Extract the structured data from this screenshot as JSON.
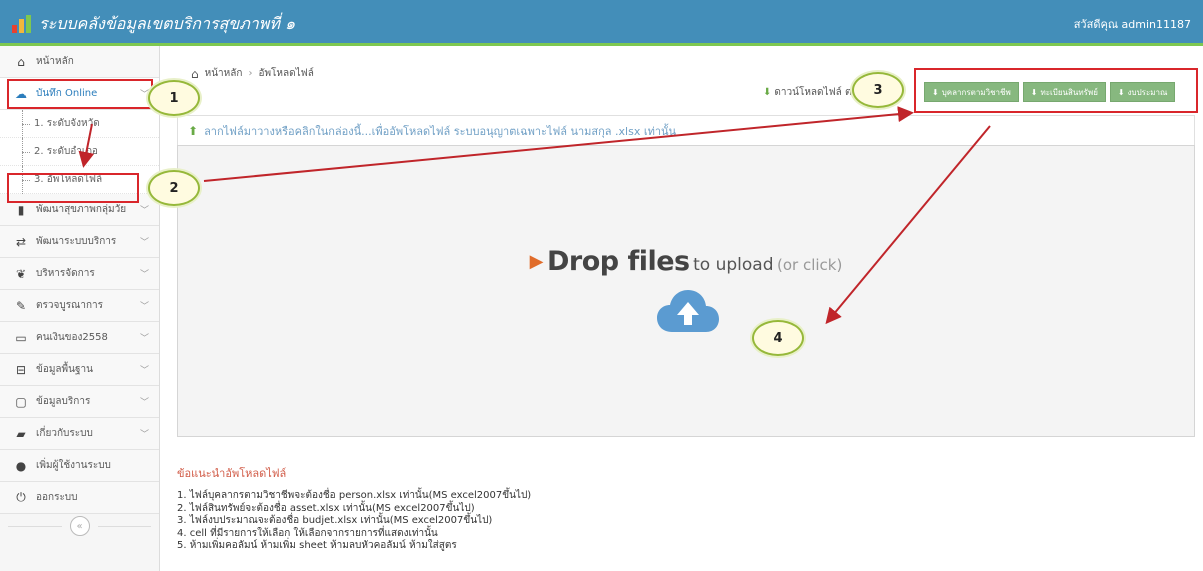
{
  "app": {
    "title": "ระบบคลังข้อมูลเขตบริการสุขภาพที่ ๑",
    "user_greeting": "สวัสดีคุณ admin11187",
    "brand_colors": [
      "#e8412f",
      "#f3b73b",
      "#7ec850"
    ]
  },
  "sidebar": {
    "items": [
      {
        "label": "หน้าหลัก",
        "icon": "home-icon",
        "glyph": "⌂"
      },
      {
        "label": "บันทึก Online",
        "icon": "cloud-upload-icon",
        "glyph": "☁",
        "expanded": true,
        "children": [
          {
            "label": "1. ระดับจังหวัด"
          },
          {
            "label": "2. ระดับอำเภอ"
          },
          {
            "label": "3. อัพโหลดไฟล์",
            "active": true
          }
        ]
      },
      {
        "label": "พัฒนาสุขภาพกลุ่มวัย",
        "icon": "bookmark-icon",
        "glyph": "▮"
      },
      {
        "label": "พัฒนาระบบบริการ",
        "icon": "exchange-icon",
        "glyph": "⇄"
      },
      {
        "label": "บริหารจัดการ",
        "icon": "leaf-icon",
        "glyph": "❦"
      },
      {
        "label": "ตรวจบูรณาการ",
        "icon": "eyedropper-icon",
        "glyph": "✎"
      },
      {
        "label": "คนเงินของ2558",
        "icon": "credit-card-icon",
        "glyph": "▭"
      },
      {
        "label": "ข้อมูลพื้นฐาน",
        "icon": "hdd-icon",
        "glyph": "⊟"
      },
      {
        "label": "ข้อมูลบริการ",
        "icon": "desktop-icon",
        "glyph": "▢"
      },
      {
        "label": "เกี่ยวกับระบบ",
        "icon": "book-icon",
        "glyph": "▰"
      },
      {
        "label": "เพิ่มผู้ใช้งานระบบ",
        "icon": "user-icon",
        "glyph": "●"
      },
      {
        "label": "ออกระบบ",
        "icon": "power-icon",
        "glyph": "⏻"
      }
    ],
    "collapse_glyph": "«"
  },
  "breadcrumb": {
    "home": "หน้าหลัก",
    "current": "อัพโหลดไฟล์",
    "separator": "›"
  },
  "download": {
    "label": "ดาวน์โหลดไฟล์ ต",
    "buttons": [
      {
        "label": "บุคลากรตามวิชาชีพ"
      },
      {
        "label": "ทะเบียนสินทรัพย์"
      },
      {
        "label": "งบประมาณ"
      }
    ]
  },
  "dropzone": {
    "header": "ลากไฟล์มาวางหรือคลิกในกล่องนี้...เพื่ออัพโหลดไฟล์ ระบบอนุญาตเฉพาะไฟล์ นามสกุล .xlsx เท่านั้น",
    "big": "Drop files",
    "small": "to upload",
    "hint": "(or click)"
  },
  "notes": {
    "title": "ข้อแนะนำอัพโหลดไฟล์",
    "items": [
      "1.  ไฟล์บุคลากรตามวิชาชีพจะต้องชื่อ person.xlsx เท่านั้น(MS excel2007ขึ้นไป)",
      "2.  ไฟล์สินทรัพย์จะต้องชื่อ asset.xlsx เท่านั้น(MS excel2007ขึ้นไป)",
      "3.  ไฟล์งบประมาณจะต้องชื่อ budjet.xlsx เท่านั้น(MS excel2007ขึ้นไป)",
      "4.  cell ที่มีรายการให้เลือก ให้เลือกจากรายการที่แสดงเท่านั้น",
      "5.  ห้ามเพิ่มคอลัมน์ ห้ามเพิ่ม sheet ห้ามลบหัวคอลัมน์ ห้ามใส่สูตร"
    ]
  },
  "annotations": {
    "bubbles": [
      "1",
      "2",
      "3",
      "4"
    ],
    "color": "#d9262b"
  }
}
